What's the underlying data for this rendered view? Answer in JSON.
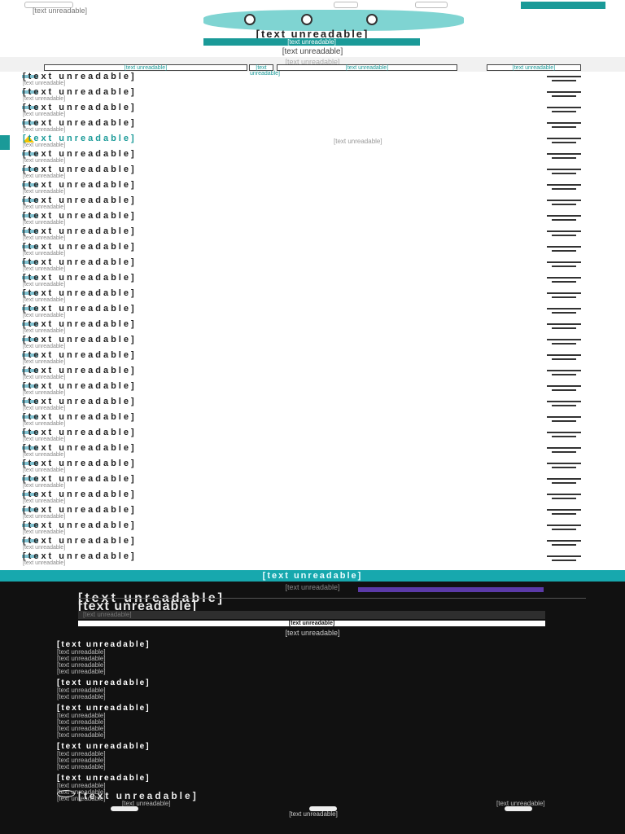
{
  "header": {
    "url_text": "[text unreadable]",
    "headline": "[text unreadable]",
    "cta": "[text unreadable]",
    "more_label": "[text unreadable]",
    "accent": "#1a9a98"
  },
  "results_bar": {
    "caption": "[text unreadable]",
    "buttons": [
      "[text unreadable]",
      "[text unreadable]",
      "[text unreadable]",
      "[text unreadable]"
    ]
  },
  "results": [
    {
      "name": "[text unreadable]",
      "sub": "[text unreadable]"
    },
    {
      "name": "[text unreadable]",
      "sub": "[text unreadable]"
    },
    {
      "name": "[text unreadable]",
      "sub": "[text unreadable]"
    },
    {
      "name": "[text unreadable]",
      "sub": "[text unreadable]"
    },
    {
      "name": "[text unreadable]",
      "sub": "[text unreadable]",
      "highlight": true,
      "note": "[text unreadable]"
    },
    {
      "name": "[text unreadable]",
      "sub": "[text unreadable]"
    },
    {
      "name": "[text unreadable]",
      "sub": "[text unreadable]"
    },
    {
      "name": "[text unreadable]",
      "sub": "[text unreadable]"
    },
    {
      "name": "[text unreadable]",
      "sub": "[text unreadable]"
    },
    {
      "name": "[text unreadable]",
      "sub": "[text unreadable]"
    },
    {
      "name": "[text unreadable]",
      "sub": "[text unreadable]"
    },
    {
      "name": "[text unreadable]",
      "sub": "[text unreadable]"
    },
    {
      "name": "[text unreadable]",
      "sub": "[text unreadable]"
    },
    {
      "name": "[text unreadable]",
      "sub": "[text unreadable]"
    },
    {
      "name": "[text unreadable]",
      "sub": "[text unreadable]"
    },
    {
      "name": "[text unreadable]",
      "sub": "[text unreadable]"
    },
    {
      "name": "[text unreadable]",
      "sub": "[text unreadable]"
    },
    {
      "name": "[text unreadable]",
      "sub": "[text unreadable]"
    },
    {
      "name": "[text unreadable]",
      "sub": "[text unreadable]"
    },
    {
      "name": "[text unreadable]",
      "sub": "[text unreadable]"
    },
    {
      "name": "[text unreadable]",
      "sub": "[text unreadable]"
    },
    {
      "name": "[text unreadable]",
      "sub": "[text unreadable]"
    },
    {
      "name": "[text unreadable]",
      "sub": "[text unreadable]"
    },
    {
      "name": "[text unreadable]",
      "sub": "[text unreadable]"
    },
    {
      "name": "[text unreadable]",
      "sub": "[text unreadable]"
    },
    {
      "name": "[text unreadable]",
      "sub": "[text unreadable]"
    },
    {
      "name": "[text unreadable]",
      "sub": "[text unreadable]"
    },
    {
      "name": "[text unreadable]",
      "sub": "[text unreadable]"
    },
    {
      "name": "[text unreadable]",
      "sub": "[text unreadable]"
    },
    {
      "name": "[text unreadable]",
      "sub": "[text unreadable]"
    },
    {
      "name": "[text unreadable]",
      "sub": "[text unreadable]"
    },
    {
      "name": "[text unreadable]",
      "sub": "[text unreadable]"
    }
  ],
  "help_bar": "[text unreadable]",
  "footer": {
    "tagline": "[text unreadable]",
    "logo": "[text unreadable]",
    "join": "[text unreadable]",
    "email_placeholder": "[text unreadable]",
    "signup_label": "[text unreadable]",
    "price_note": "[text unreadable]",
    "sections": [
      {
        "title": "[text unreadable]",
        "items": [
          "[text unreadable]",
          "[text unreadable]",
          "[text unreadable]",
          "[text unreadable]"
        ]
      },
      {
        "title": "[text unreadable]",
        "items": [
          "[text unreadable]",
          "[text unreadable]"
        ]
      },
      {
        "title": "[text unreadable]",
        "items": [
          "[text unreadable]",
          "[text unreadable]",
          "[text unreadable]",
          "[text unreadable]"
        ]
      },
      {
        "title": "[text unreadable]",
        "items": [
          "[text unreadable]",
          "[text unreadable]",
          "[text unreadable]"
        ]
      },
      {
        "title": "[text unreadable]",
        "items": [
          "[text unreadable]",
          "[text unreadable]",
          "[text unreadable]"
        ]
      }
    ],
    "brand": "[text unreadable]",
    "locale": "[text unreadable]",
    "currency": "[text unreadable]",
    "legal": "[text unreadable]"
  }
}
